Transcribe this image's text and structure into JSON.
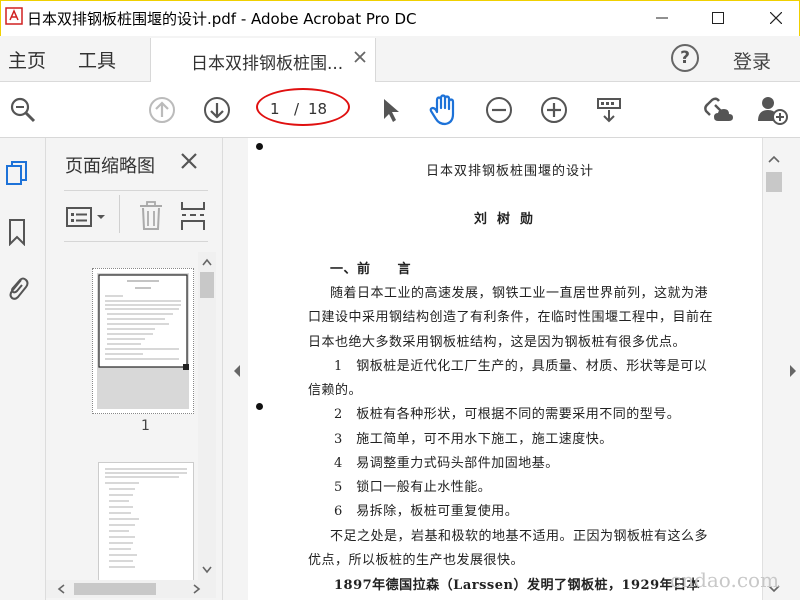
{
  "window": {
    "title": "日本双排钢板桩围堰的设计.pdf - Adobe Acrobat Pro DC"
  },
  "menu": {
    "home": "主页",
    "tools": "工具",
    "doc_tab": "日本双排钢板桩围...",
    "login": "登录",
    "help": "?"
  },
  "toolbar": {
    "current_page": "1",
    "separator": "/",
    "total_pages": "18"
  },
  "panel": {
    "title": "页面缩略图",
    "thumb_labels": [
      "1"
    ]
  },
  "document": {
    "title": "日本双排钢板桩围堰的设计",
    "author": "刘树勋",
    "lines": [
      "一、前　　言",
      "随着日本工业的高速发展，钢铁工业一直居世界前列，这就为港",
      "口建设中采用钢结构创造了有利条件，在临时性围堰工程中，目前在",
      "日本也绝大多数采用钢板桩结构，这是因为钢板桩有很多优点。",
      "1　钢板桩是近代化工厂生产的，具质量、材质、形状等是可以",
      "信赖的。",
      "2　板桩有各种形状，可根据不同的需要采用不同的型号。",
      "3　施工简单，可不用水下施工，施工速度快。",
      "4　易调整重力式码头部件加固地基。",
      "5　锁口一般有止水性能。",
      "6　易拆除，板桩可重复使用。",
      "不足之处是，岩基和极软的地基不适用。正因为钢板桩有这么多",
      "优点，所以板桩的生产也发展很快。",
      "1897年德国拉森（Larssen）发明了钢板桩，1929年日本"
    ]
  },
  "watermark": "cndao.com"
}
